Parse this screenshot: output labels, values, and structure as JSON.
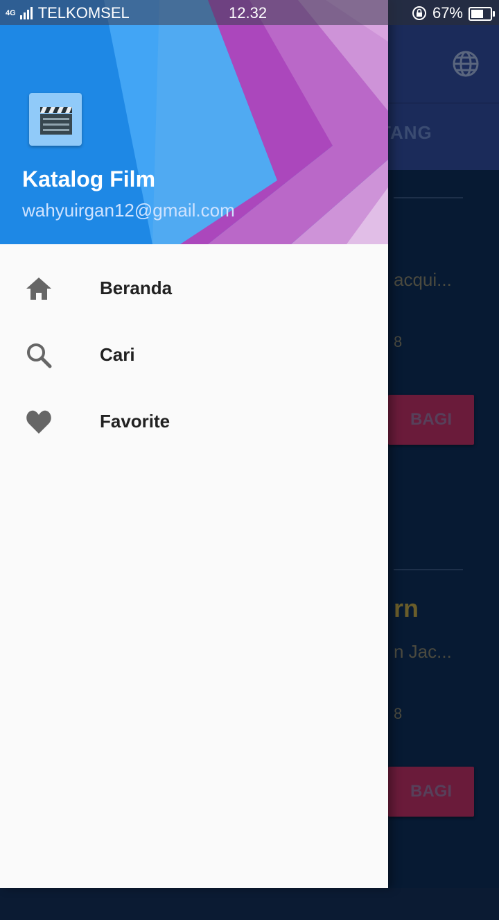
{
  "status_bar": {
    "network": "4G",
    "carrier": "TELKOMSEL",
    "time": "12.32",
    "battery_percent": "67%",
    "battery_level": 0.67
  },
  "background_app": {
    "tab_label": "TANG",
    "cards": [
      {
        "overview": "acqui...",
        "date": "8",
        "share_label": "BAGI"
      },
      {
        "title": "rn",
        "overview": "n Jac...",
        "date": "8",
        "share_label": "BAGI"
      }
    ],
    "icons": {
      "language": "globe-icon"
    }
  },
  "drawer": {
    "app_name": "Katalog Film",
    "email": "wahyuirgan12@gmail.com",
    "app_icon": "clapperboard-icon",
    "colors": {
      "header_blue": "#1e88e5",
      "header_purple": "#ab47bc",
      "icon_grey": "#666666"
    },
    "menu": [
      {
        "label": "Beranda",
        "icon": "home-icon"
      },
      {
        "label": "Cari",
        "icon": "search-icon"
      },
      {
        "label": "Favorite",
        "icon": "heart-icon"
      }
    ]
  }
}
